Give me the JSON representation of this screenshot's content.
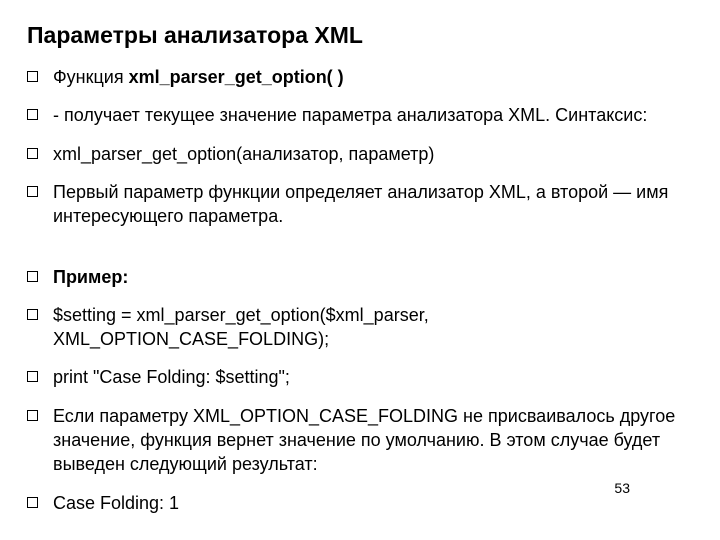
{
  "title": "Параметры анализатора XML",
  "items": [
    {
      "prefix": "Функция ",
      "bold": "xml_parser_get_option( )",
      "suffix": ""
    },
    {
      "text": "- получает текущее значение параметра анализатора XML. Синтаксис:"
    },
    {
      "text": "xml_parser_get_option(анализатор, параметр)"
    },
    {
      "text": "Первый параметр функции определяет анализатор XML, а второй — имя интересующего параметра.",
      "gap": true
    },
    {
      "bold": "Пример:"
    },
    {
      "text": "$setting = xml_parser_get_option($xml_parser, XML_OPTION_CASE_FOLDING);"
    },
    {
      "text": "print \"Case Folding: $setting\";"
    },
    {
      "text": "Если параметру XML_OPTION_CASE_FOLDING не присваивалось другое значение, функция вернет значение по умолчанию. В этом случае будет выведен следующий результат:"
    },
    {
      "text": "Case Folding: 1"
    }
  ],
  "page": "53"
}
